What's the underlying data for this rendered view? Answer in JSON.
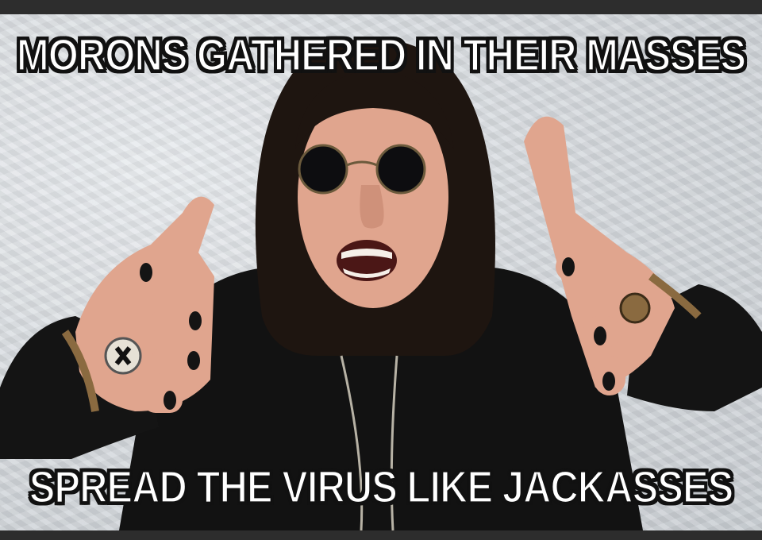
{
  "meme": {
    "top_text": "MORONS GATHERED IN THEIR MASSES",
    "bottom_text": "SPREAD THE VIRUS LIKE JACKASSES"
  },
  "colors": {
    "frame": "#2d2d2d",
    "wall": "#d7dbdf",
    "clothing": "#121212",
    "skin": "#e0a58e",
    "hair": "#1e1510",
    "caption_fill": "#ffffff",
    "caption_outline": "#111111"
  }
}
